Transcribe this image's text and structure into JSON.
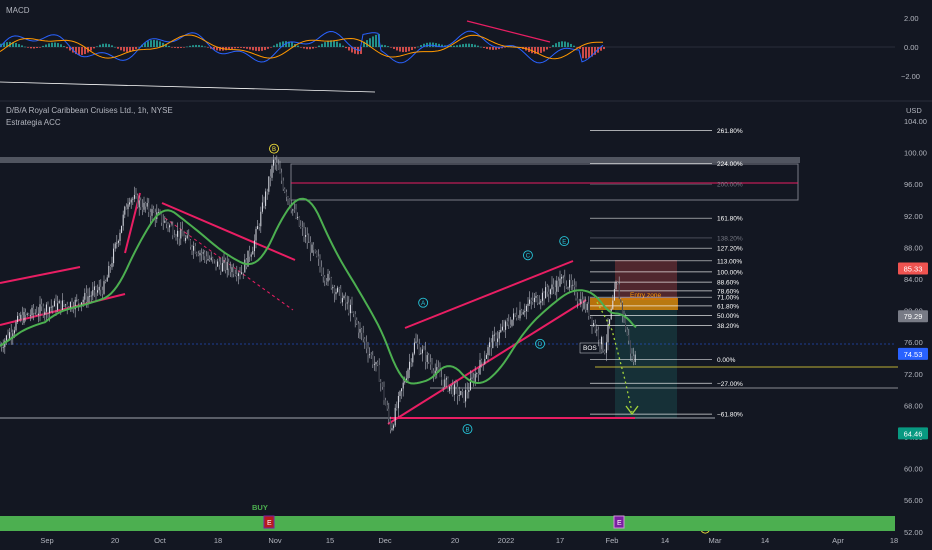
{
  "macd": {
    "title": "MACD",
    "ticks": [
      "2.00",
      "0.00",
      "−2.00"
    ]
  },
  "main": {
    "title": "D/B/A Royal Caribbean Cruises Ltd., 1h, NYSE",
    "subtitle": "Estrategia ACC",
    "currency": "USD"
  },
  "colors": {
    "background": "#131722",
    "yellow_ma": "#f5e33b",
    "green_ma": "#4caf50",
    "channel": "#e91e63",
    "bottom_bar": "#4caf50",
    "fib": "#ffffff",
    "macd_fast": "#2962ff",
    "macd_slow": "#ff9800",
    "macd_hist_pos": "#26a69a",
    "macd_hist_neg": "#ef5350"
  },
  "chart_data": {
    "type": "candlestick",
    "title": "D/B/A Royal Caribbean Cruises Ltd., 1h, NYSE",
    "y_axis": {
      "ticks": [
        104,
        100,
        96,
        92,
        88,
        84,
        80,
        76,
        72,
        68,
        64,
        60,
        56,
        52
      ],
      "tick_labels": [
        "104.00",
        "100.00",
        "96.00",
        "92.00",
        "88.00",
        "84.00",
        "80.00",
        "76.00",
        "72.00",
        "68.00",
        "64.00",
        "60.00",
        "56.00",
        "52.00"
      ],
      "ylim": [
        50.5,
        106
      ]
    },
    "x_axis": {
      "tick_labels": [
        "Sep",
        "20",
        "Oct",
        "18",
        "Nov",
        "15",
        "Dec",
        "20",
        "2022",
        "17",
        "Feb",
        "14",
        "Mar",
        "14",
        "Apr",
        "18"
      ]
    },
    "price_series_approx": [
      {
        "x": "Aug 27",
        "y": 75.5
      },
      {
        "x": "Sep 1",
        "y": 79
      },
      {
        "x": "Sep 8",
        "y": 80.5
      },
      {
        "x": "Sep 15",
        "y": 81
      },
      {
        "x": "Sep 22",
        "y": 83
      },
      {
        "x": "Sep 28",
        "y": 94.5
      },
      {
        "x": "Oct 5",
        "y": 92
      },
      {
        "x": "Oct 12",
        "y": 89
      },
      {
        "x": "Oct 19",
        "y": 86
      },
      {
        "x": "Oct 26",
        "y": 85
      },
      {
        "x": "Oct 29",
        "y": 88.5
      },
      {
        "x": "Nov 3",
        "y": 99
      },
      {
        "x": "Nov 9",
        "y": 91
      },
      {
        "x": "Nov 15",
        "y": 85
      },
      {
        "x": "Nov 22",
        "y": 80
      },
      {
        "x": "Nov 29",
        "y": 72
      },
      {
        "x": "Dec 2",
        "y": 65
      },
      {
        "x": "Dec 8",
        "y": 76
      },
      {
        "x": "Dec 15",
        "y": 71
      },
      {
        "x": "Dec 20",
        "y": 69
      },
      {
        "x": "Dec 27",
        "y": 76
      },
      {
        "x": "Jan 3",
        "y": 80
      },
      {
        "x": "Jan 10",
        "y": 82.5
      },
      {
        "x": "Jan 14",
        "y": 84
      },
      {
        "x": "Jan 20",
        "y": 80
      },
      {
        "x": "Jan 24",
        "y": 75
      },
      {
        "x": "Jan 27",
        "y": 83.5
      },
      {
        "x": "Jan 31",
        "y": 73.5
      },
      {
        "x": "Feb 1",
        "y": 74.5
      }
    ],
    "price_labels": [
      {
        "text": "85.33",
        "value": 85.33,
        "color": "#ef5350"
      },
      {
        "text": "79.29",
        "value": 79.29,
        "color": "#787b86"
      },
      {
        "text": "74.53",
        "value": 74.53,
        "color": "#2962ff"
      },
      {
        "text": "64.46",
        "value": 64.46,
        "color": "#089981"
      }
    ],
    "fib_levels": [
      {
        "label": "261.80%",
        "value": 102.8,
        "color": "#ffffff"
      },
      {
        "label": "224.00%",
        "value": 98.6,
        "color": "#ffffff"
      },
      {
        "label": "200.00%",
        "value": 96.0,
        "color": "#787b86"
      },
      {
        "label": "161.80%",
        "value": 91.7,
        "color": "#ffffff"
      },
      {
        "label": "138.20%",
        "value": 89.2,
        "color": "#787b86"
      },
      {
        "label": "127.20%",
        "value": 87.9,
        "color": "#ffffff"
      },
      {
        "label": "113.00%",
        "value": 86.3,
        "color": "#ffffff"
      },
      {
        "label": "100.00%",
        "value": 84.9,
        "color": "#ffffff"
      },
      {
        "label": "88.60%",
        "value": 83.6,
        "color": "#ffffff"
      },
      {
        "label": "78.60%",
        "value": 82.5,
        "color": "#ffffff"
      },
      {
        "label": "71.00%",
        "value": 81.7,
        "color": "#ffffff"
      },
      {
        "label": "61.80%",
        "value": 80.6,
        "color": "#ffffff"
      },
      {
        "label": "50.00%",
        "value": 79.4,
        "color": "#ffffff"
      },
      {
        "label": "38.20%",
        "value": 78.1,
        "color": "#ffffff"
      },
      {
        "label": "0.00%",
        "value": 73.8,
        "color": "#ffffff"
      },
      {
        "label": "−27.00%",
        "value": 70.8,
        "color": "#ffffff"
      },
      {
        "label": "−61.80%",
        "value": 66.9,
        "color": "#ffffff"
      }
    ],
    "wave_labels": [
      {
        "text": "B",
        "x": "Nov 3",
        "y": 100.5,
        "color": "#f5e33b"
      },
      {
        "text": "A",
        "x": "Dec 10",
        "y": 81,
        "color": "#26c6da"
      },
      {
        "text": "B",
        "x": "Dec 21",
        "y": 65,
        "color": "#26c6da"
      },
      {
        "text": "C",
        "x": "Jan 5",
        "y": 87,
        "color": "#26c6da"
      },
      {
        "text": "D",
        "x": "Jan 8",
        "y": 75.8,
        "color": "#26c6da"
      },
      {
        "text": "E",
        "x": "Jan 14",
        "y": 88.8,
        "color": "#26c6da"
      },
      {
        "text": "C",
        "x": "Feb 18",
        "y": 52.4,
        "color": "#f5e33b"
      }
    ],
    "annotations": [
      "Entry zone",
      "BOS",
      "BUY"
    ],
    "bottom_markers": [
      "E",
      "E"
    ]
  }
}
